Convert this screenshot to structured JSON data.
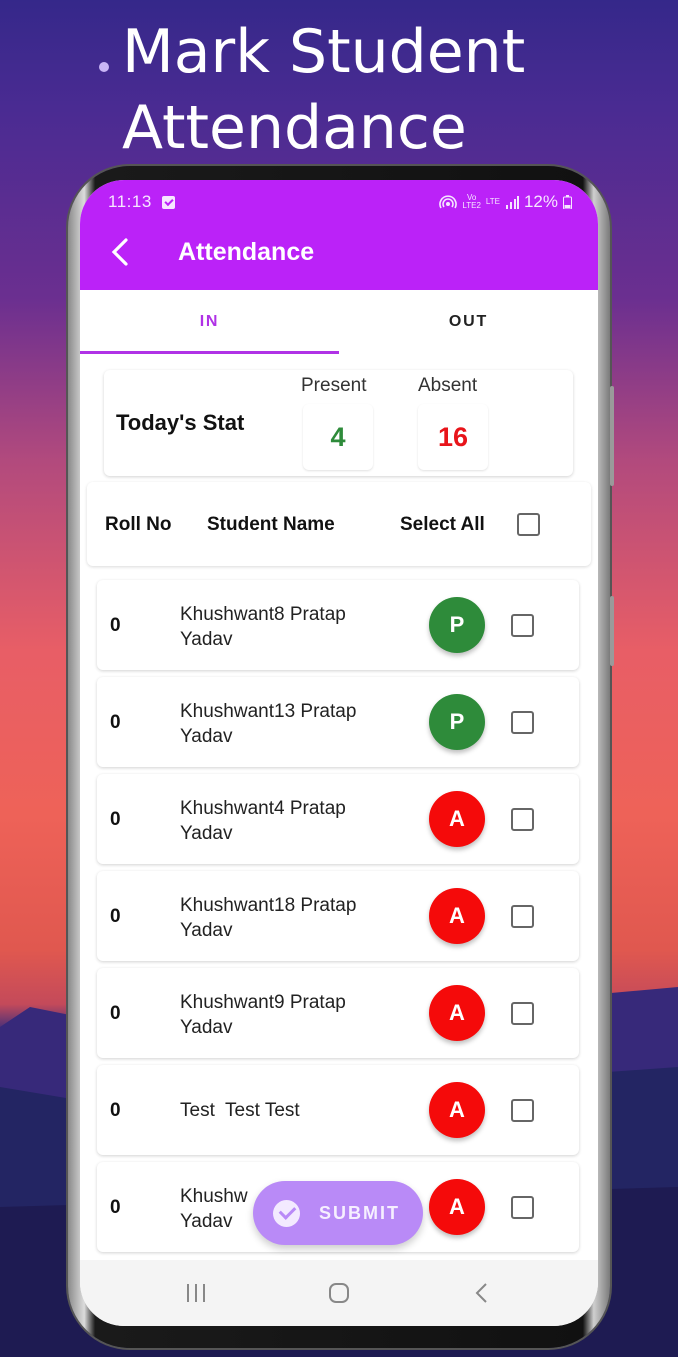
{
  "promo": {
    "title_line1": "Mark Student",
    "title_line2": "Attendance"
  },
  "status_bar": {
    "time": "11:13",
    "volte": "VoLTE2",
    "network": "LTE",
    "battery": "12%"
  },
  "app_bar": {
    "title": "Attendance",
    "color": "#bb22f8"
  },
  "tabs": [
    {
      "label": "IN",
      "active": true
    },
    {
      "label": "OUT",
      "active": false
    }
  ],
  "stats": {
    "title": "Today's Stat",
    "present_label": "Present",
    "present_value": "4",
    "absent_label": "Absent",
    "absent_value": "16",
    "present_color": "#2e8b3a",
    "absent_color": "#e8141a"
  },
  "table_header": {
    "roll_no": "Roll No",
    "student_name": "Student Name",
    "select_all": "Select All",
    "select_all_checked": false
  },
  "students": [
    {
      "roll": "0",
      "name_line1": "Khushwant8 Pratap",
      "name_line2": "Yadav",
      "status": "P",
      "checked": false
    },
    {
      "roll": "0",
      "name_line1": "Khushwant13 Pratap",
      "name_line2": "Yadav",
      "status": "P",
      "checked": false
    },
    {
      "roll": "0",
      "name_line1": "Khushwant4 Pratap",
      "name_line2": "Yadav",
      "status": "A",
      "checked": false
    },
    {
      "roll": "0",
      "name_line1": "Khushwant18 Pratap",
      "name_line2": "Yadav",
      "status": "A",
      "checked": false
    },
    {
      "roll": "0",
      "name_line1": "Khushwant9 Pratap",
      "name_line2": "Yadav",
      "status": "A",
      "checked": false
    },
    {
      "roll": "0",
      "name_line1": "Test  Test Test",
      "name_line2": "",
      "status": "A",
      "checked": false
    },
    {
      "roll": "0",
      "name_line1": "Khushw",
      "name_line2": "Yadav",
      "status": "A",
      "checked": false
    }
  ],
  "status_colors": {
    "P": "#2e8b3a",
    "A": "#f50a0a"
  },
  "submit_button": {
    "label": "SUBMIT",
    "color": "#b98af7"
  },
  "nav_bar": {
    "recent": "recent-apps",
    "home": "home",
    "back": "back"
  }
}
